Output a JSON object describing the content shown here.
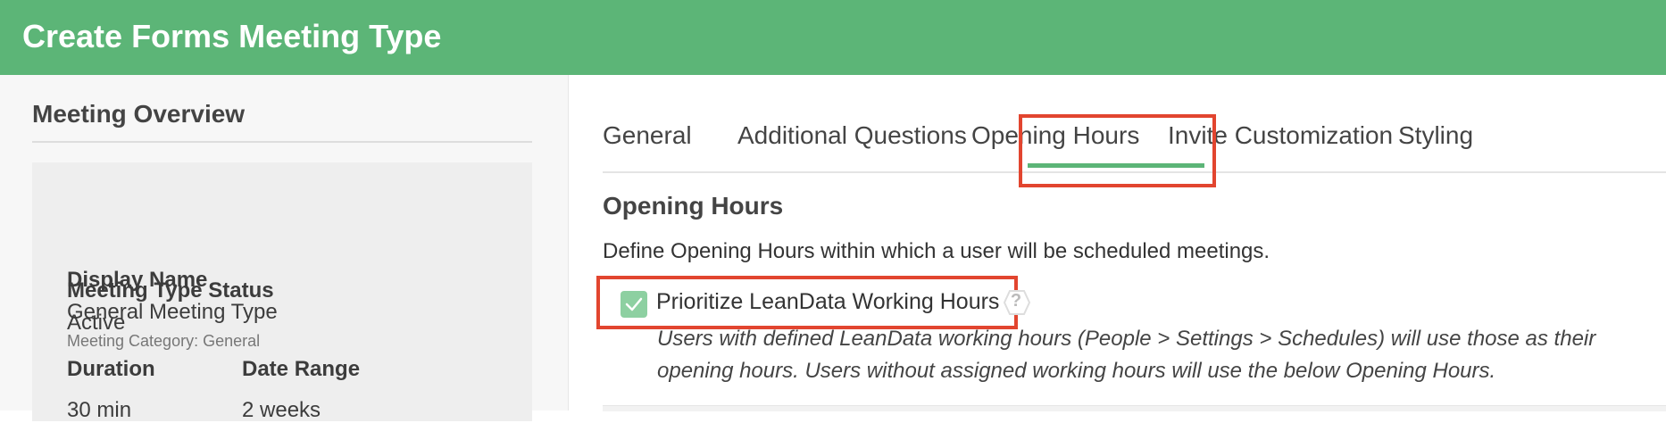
{
  "header": {
    "title": "Create Forms Meeting Type",
    "bg_color": "#5cb577"
  },
  "sidebar": {
    "title": "Meeting Overview",
    "display_name_label": "Display Name",
    "display_name_value": "General Meeting Type",
    "meeting_category": "Meeting Category: General",
    "status_label": "Meeting Type Status",
    "status_value": "Active",
    "duration_label": "Duration",
    "duration_value": "30 min",
    "date_range_label": "Date Range",
    "date_range_value": "2 weeks"
  },
  "tabs": [
    {
      "label": "General",
      "active": false
    },
    {
      "label": "Additional Questions",
      "active": false
    },
    {
      "label": "Opening Hours",
      "active": true
    },
    {
      "label": "Invite Customization",
      "active": false
    },
    {
      "label": "Styling",
      "active": false
    }
  ],
  "main": {
    "section_title": "Opening Hours",
    "section_description": "Define Opening Hours within which a user will be scheduled meetings.",
    "checkbox_label": "Prioritize LeanData Working Hours",
    "checkbox_checked": true,
    "help_icon": "question-icon",
    "note_line1": "Users with defined LeanData working hours (People > Settings > Schedules) will use those as their",
    "note_line2": "opening hours. Users without assigned working hours will use the below Opening Hours."
  },
  "colors": {
    "accent": "#5cb577",
    "highlight": "#e2452f",
    "checkbox": "#8dd0a1"
  }
}
